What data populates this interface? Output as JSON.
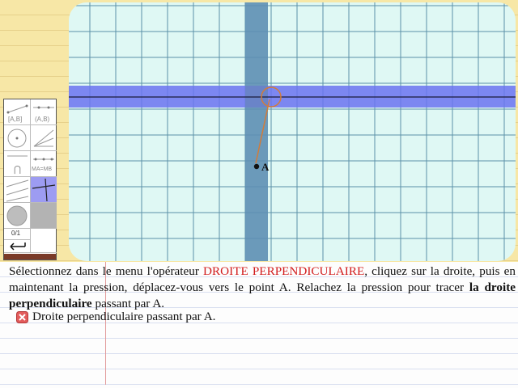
{
  "toolbar": {
    "labels": {
      "segment": "[A,B]",
      "segment2": "(A,B)",
      "arc": "⋂",
      "midpoint": "MA=MB",
      "counter": "0/1"
    },
    "undo_icon": "undo-arrow-icon"
  },
  "canvas": {
    "point_label": "A",
    "colors": {
      "grid_bg": "#dff8f4",
      "grid_line": "#2f6f8f",
      "blue_band": "#6b73f0",
      "vertical_band": "#5e8fb4",
      "drag_line": "#d27c3a"
    }
  },
  "instructions": {
    "part1": "Sélectionnez dans le menu l'opérateur ",
    "operator": "DROITE PERPENDICULAIRE",
    "part2": ", cliquez sur la droite, puis en maintenant la pression, déplacez-vous vers le point A. Relachez la pression pour tracer la ",
    "bold": "la droite perpendiculaire",
    "part3": " passant par A."
  },
  "task": {
    "label": "Droite perpendiculaire passant par A.",
    "status_icon": "failed-status-icon"
  }
}
